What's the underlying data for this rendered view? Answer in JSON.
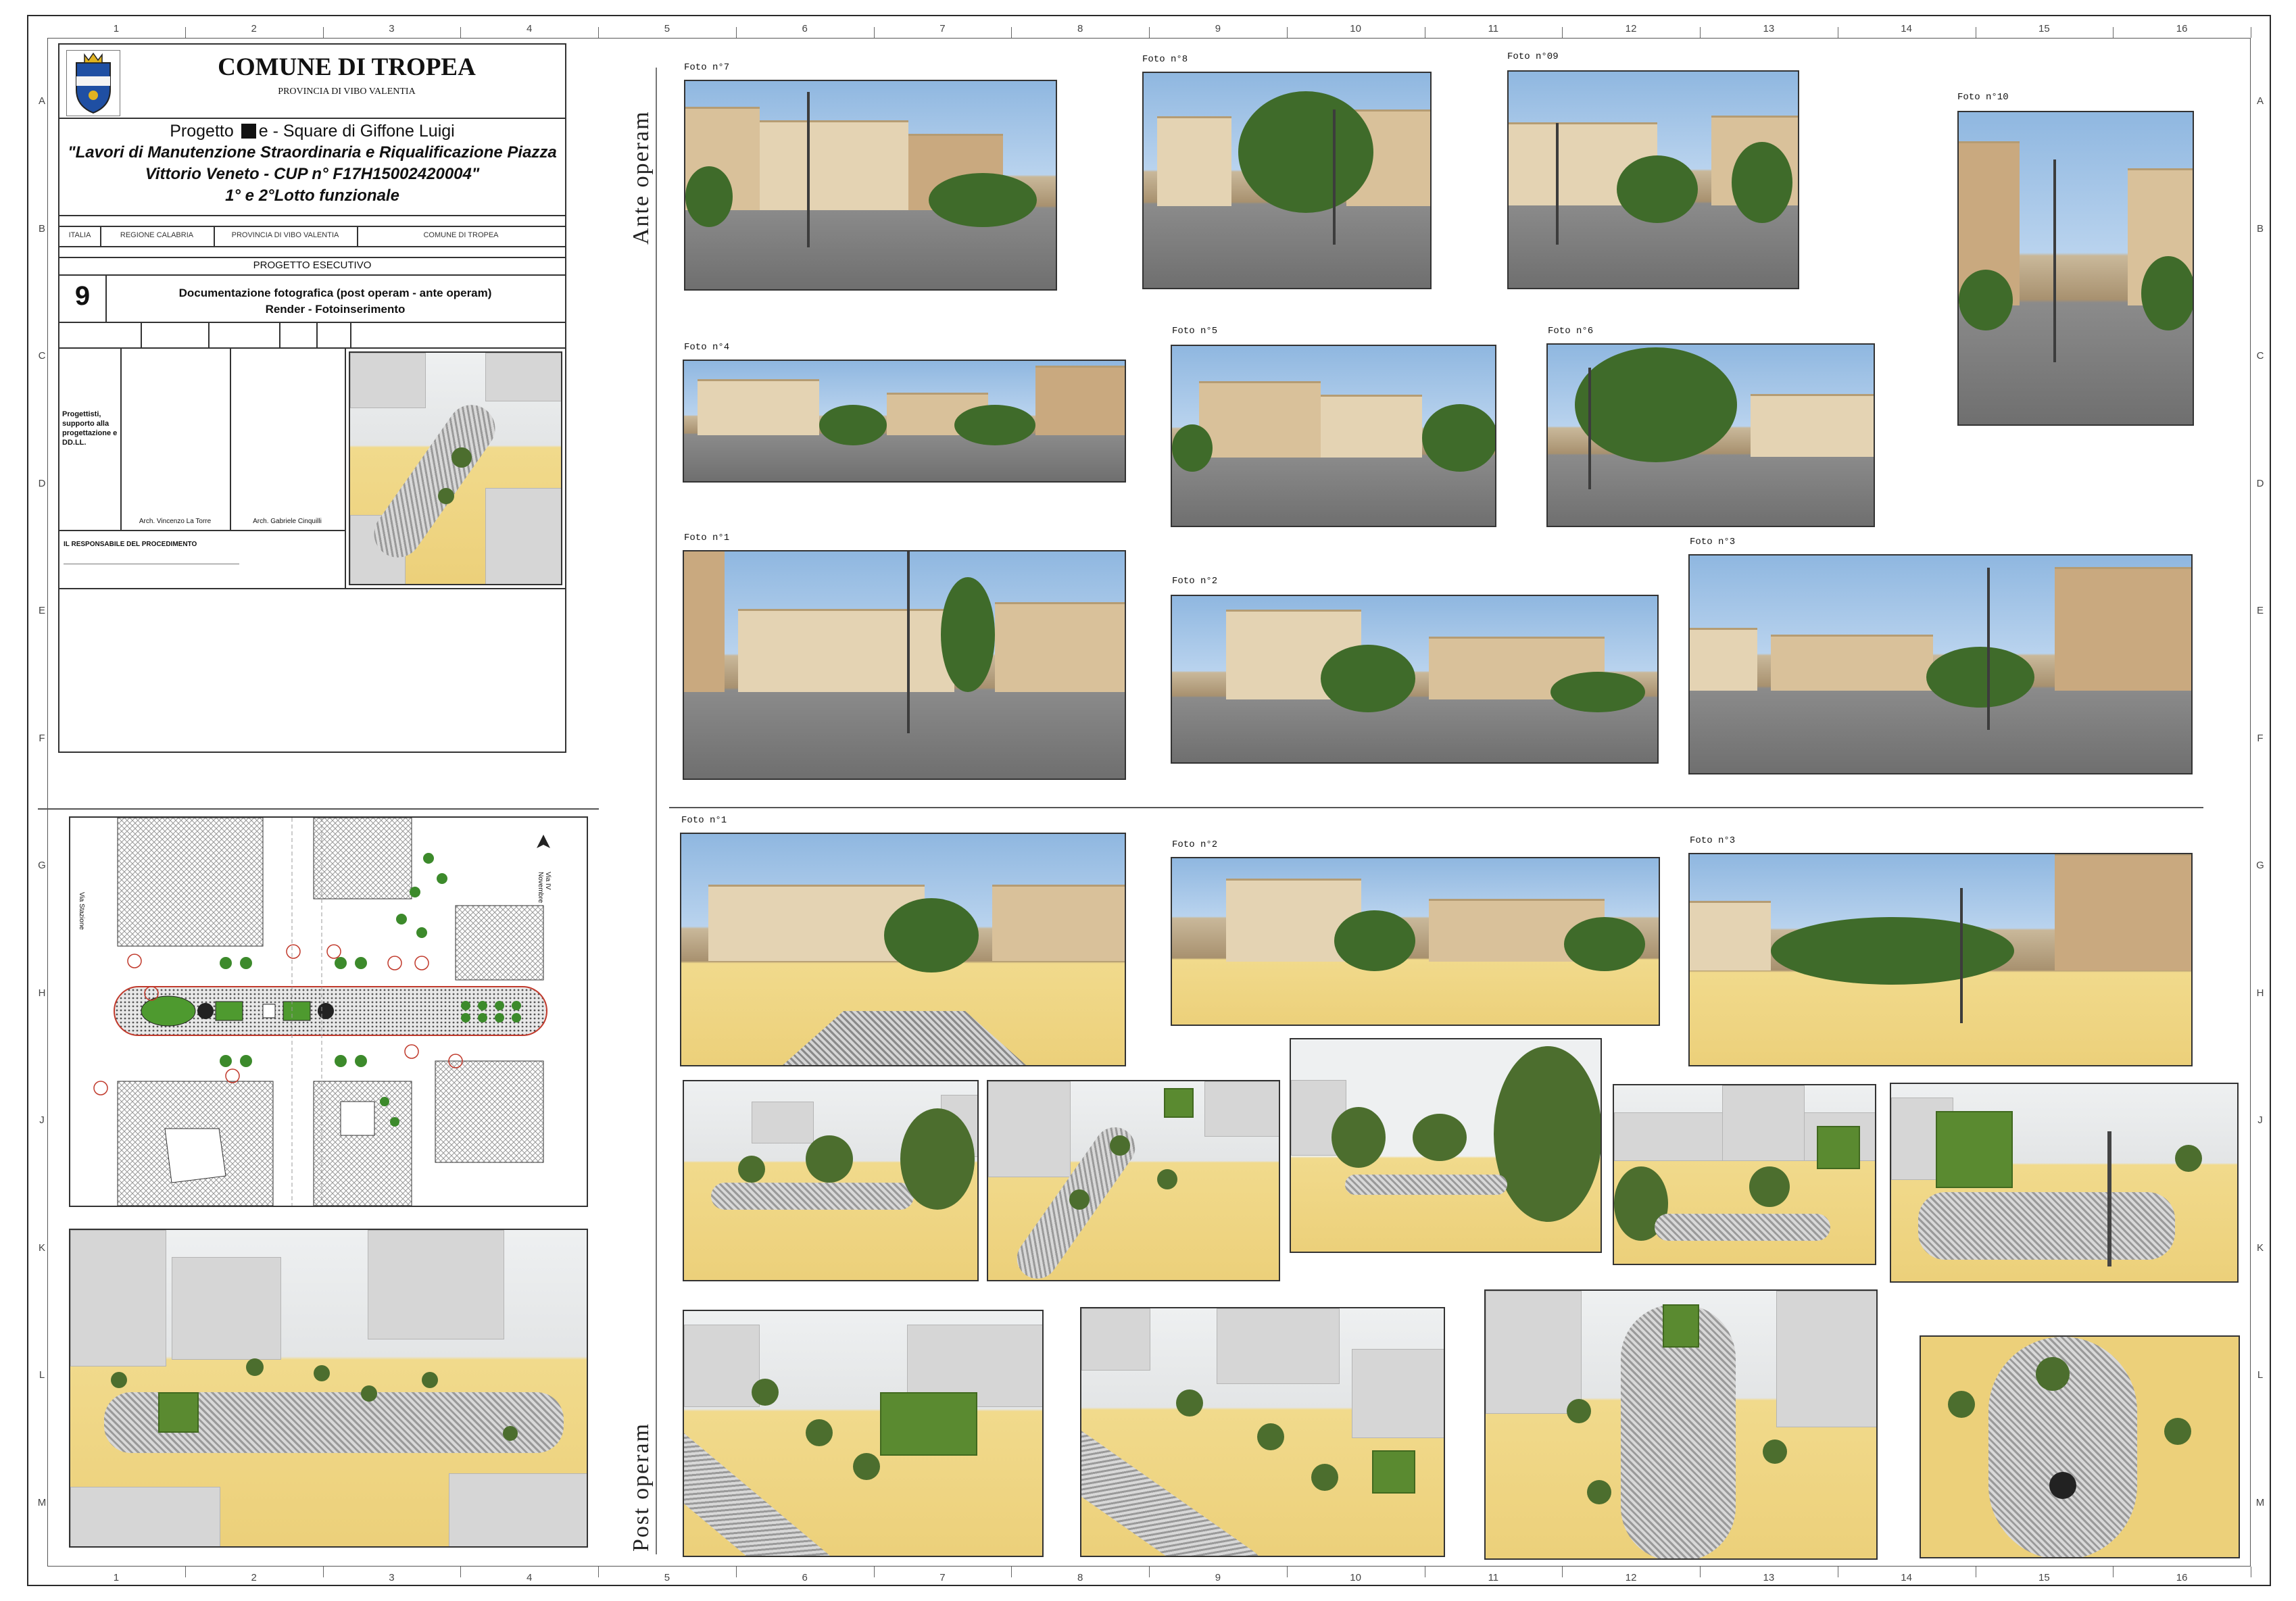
{
  "title_block": {
    "municipality": "COMUNE DI TROPEA",
    "province": "PROVINCIA DI VIBO VALENTIA",
    "project_line_a": "Progetto",
    "project_line_b": "e - Square di Giffone Luigi",
    "project_desc_1": "\"Lavori di Manutenzione Straordinaria e Riqualificazione Piazza",
    "project_desc_2": "Vittorio Veneto - CUP n° F17H15002420004\"",
    "project_desc_3": "1° e 2°Lotto funzionale",
    "location_row": [
      "ITALIA",
      "REGIONE CALABRIA",
      "PROVINCIA DI VIBO VALENTIA",
      "COMUNE DI TROPEA"
    ],
    "phase": "PROGETTO ESECUTIVO",
    "sheet_number": "9",
    "doc_title_1": "Documentazione fotografica (post operam - ante operam)",
    "doc_title_2": "Render - Fotoinserimento",
    "designers_label": "Progettisti, supporto alla progettazione e DD.LL.",
    "designer_1": "Arch. Vincenzo La Torre",
    "designer_2": "Arch. Gabriele Cinquilli",
    "responsible_label": "IL RESPONSABILE DEL PROCEDIMENTO"
  },
  "grid": {
    "columns": [
      "1",
      "2",
      "3",
      "4",
      "5",
      "6",
      "7",
      "8",
      "9",
      "10",
      "11",
      "12",
      "13",
      "14",
      "15",
      "16"
    ],
    "rows": [
      "A",
      "B",
      "C",
      "D",
      "E",
      "F",
      "G",
      "H",
      "J",
      "K",
      "L",
      "M"
    ]
  },
  "sections": {
    "ante": "Ante operam",
    "post": "Post operam"
  },
  "ante_photos": [
    {
      "id": "a7",
      "caption": "Foto n°7"
    },
    {
      "id": "a8",
      "caption": "Foto n°8"
    },
    {
      "id": "a9",
      "caption": "Foto n°09"
    },
    {
      "id": "a10",
      "caption": "Foto n°10"
    },
    {
      "id": "a4",
      "caption": "Foto n°4"
    },
    {
      "id": "a5",
      "caption": "Foto n°5"
    },
    {
      "id": "a6",
      "caption": "Foto n°6"
    },
    {
      "id": "a1",
      "caption": "Foto n°1"
    },
    {
      "id": "a2",
      "caption": "Foto n°2"
    },
    {
      "id": "a3",
      "caption": "Foto n°3"
    }
  ],
  "post_photos": [
    {
      "id": "p1",
      "caption": "Foto n°1"
    },
    {
      "id": "p2",
      "caption": "Foto n°2"
    },
    {
      "id": "p3",
      "caption": "Foto n°3"
    }
  ],
  "plan": {
    "street_left": "Via Stazione",
    "street_right": "Via IV Novembre",
    "markers": [
      "1",
      "2",
      "3",
      "4",
      "5",
      "6",
      "7",
      "8",
      "9",
      "10"
    ]
  }
}
